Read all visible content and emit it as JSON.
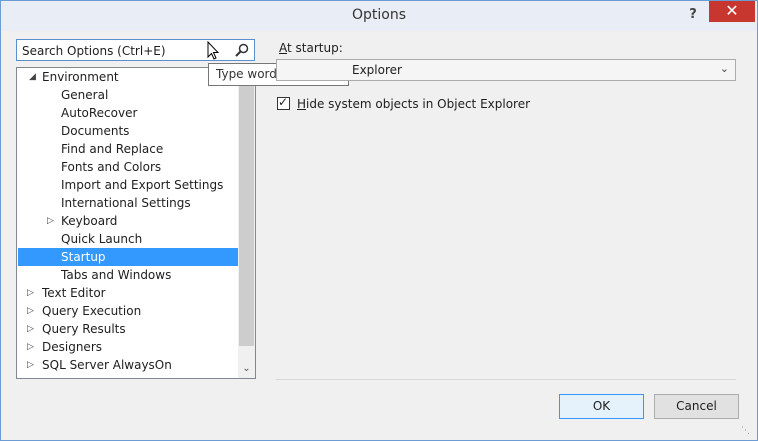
{
  "window": {
    "title": "Options",
    "help": "?",
    "close": "✕"
  },
  "search": {
    "placeholder": "Search Options (Ctrl+E)",
    "tooltip": "Type words to search for"
  },
  "tree": {
    "items": [
      {
        "label": "Environment",
        "expander": "◢"
      },
      {
        "label": "General"
      },
      {
        "label": "AutoRecover"
      },
      {
        "label": "Documents"
      },
      {
        "label": "Find and Replace"
      },
      {
        "label": "Fonts and Colors"
      },
      {
        "label": "Import and Export Settings"
      },
      {
        "label": "International Settings"
      },
      {
        "label": "Keyboard",
        "expander": "▷"
      },
      {
        "label": "Quick Launch"
      },
      {
        "label": "Startup"
      },
      {
        "label": "Tabs and Windows"
      },
      {
        "label": "Text Editor",
        "expander": "▷"
      },
      {
        "label": "Query Execution",
        "expander": "▷"
      },
      {
        "label": "Query Results",
        "expander": "▷"
      },
      {
        "label": "Designers",
        "expander": "▷"
      },
      {
        "label": "SQL Server AlwaysOn",
        "expander": "▷"
      }
    ],
    "selected": "Startup",
    "scroll_down": "⌄"
  },
  "startup": {
    "label_prefix": "A",
    "label_rest": "t startup:",
    "value": "Explorer",
    "arrow": "⌄"
  },
  "checkbox": {
    "checked": true,
    "tick": "✓",
    "label_prefix": "H",
    "label_rest": "ide system objects in Object Explorer"
  },
  "buttons": {
    "ok": "OK",
    "cancel": "Cancel"
  },
  "grip": "⋱"
}
